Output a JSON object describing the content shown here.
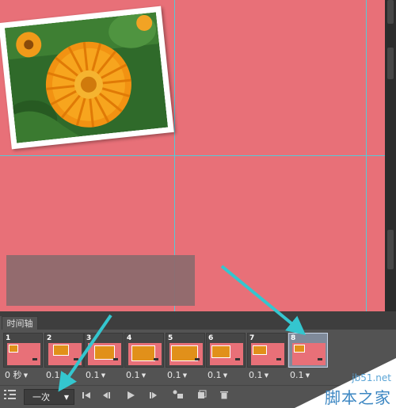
{
  "panel": {
    "tab_label": "时间轴"
  },
  "frames": [
    {
      "number": "1",
      "delay": "0 秒"
    },
    {
      "number": "2",
      "delay": "0.1"
    },
    {
      "number": "3",
      "delay": "0.1"
    },
    {
      "number": "4",
      "delay": "0.1"
    },
    {
      "number": "5",
      "delay": "0.1"
    },
    {
      "number": "6",
      "delay": "0.1"
    },
    {
      "number": "7",
      "delay": "0.1"
    },
    {
      "number": "8",
      "delay": "0.1"
    }
  ],
  "toolbar": {
    "loop_value": "一次"
  },
  "watermark": {
    "url": "jb51.net",
    "name": "脚本之家"
  },
  "colors": {
    "canvas": "#e87078",
    "guide": "#57c9d6",
    "arrow": "#34c6cf",
    "panel": "#535353"
  },
  "icons": [
    "timeline-convert-icon",
    "first-frame-icon",
    "previous-frame-icon",
    "play-icon",
    "next-frame-icon",
    "tween-icon",
    "duplicate-frame-icon",
    "trash-icon"
  ]
}
